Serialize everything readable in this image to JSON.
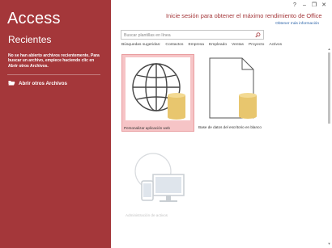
{
  "sidebar": {
    "app_title": "Access",
    "recent_heading": "Recientes",
    "empty_message": "No se han abierto archivos recientemente. Para buscar un archivo, empiece haciendo clic en Abrir otros Archivos.",
    "open_other_label": "Abrir otros Archivos",
    "bg_color": "#a4373a"
  },
  "header": {
    "headline": "Inicie sesión para obtener el máximo rendimiento de Office",
    "more_info": "Obtener más información",
    "window_buttons": [
      "?",
      "–",
      "❐",
      "✕"
    ]
  },
  "search": {
    "placeholder": "Buscar plantillas en línea"
  },
  "categories": [
    "Búsquedas sugeridas:",
    "Contactos",
    "Empresa",
    "Empleado",
    "Ventas",
    "Proyecto",
    "Activos"
  ],
  "templates": [
    {
      "label": "Personalizar aplicación web",
      "icon": "globe-database-icon",
      "selected": true
    },
    {
      "label": "Base de datos del escritorio en blanco",
      "icon": "blank-document-database-icon",
      "selected": false
    },
    {
      "label": "Administración de activos",
      "icon": "devices-icon",
      "selected": false
    }
  ],
  "colors": {
    "accent": "#a4373a",
    "selected_tile": "#f6c4c6",
    "database": "#e8c66e"
  }
}
